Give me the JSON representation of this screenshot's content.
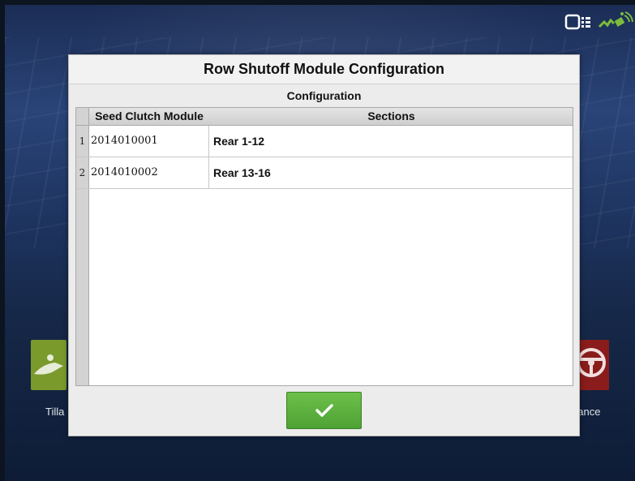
{
  "status_bar": {
    "display_icon": "display-connection-icon",
    "gps_icon": "gps-satellite-icon",
    "gps_color": "#7dbb3c"
  },
  "background_apps": {
    "tillage": {
      "label": "Tilla",
      "icon": "tillage-icon",
      "color": "#7a9a2c"
    },
    "guidance": {
      "label": "dance",
      "icon": "steering-wheel-icon",
      "color": "#8a1c1c"
    }
  },
  "dialog": {
    "title": "Row Shutoff Module Configuration",
    "section_label": "Configuration",
    "columns": [
      "Seed Clutch Module",
      "Sections"
    ],
    "rows": [
      {
        "num": "1",
        "module": "2014010001",
        "sections": "Rear 1-12"
      },
      {
        "num": "2",
        "module": "2014010002",
        "sections": "Rear 13-16"
      }
    ],
    "ok_icon": "checkmark-icon",
    "ok_color": "#5cb33e"
  }
}
